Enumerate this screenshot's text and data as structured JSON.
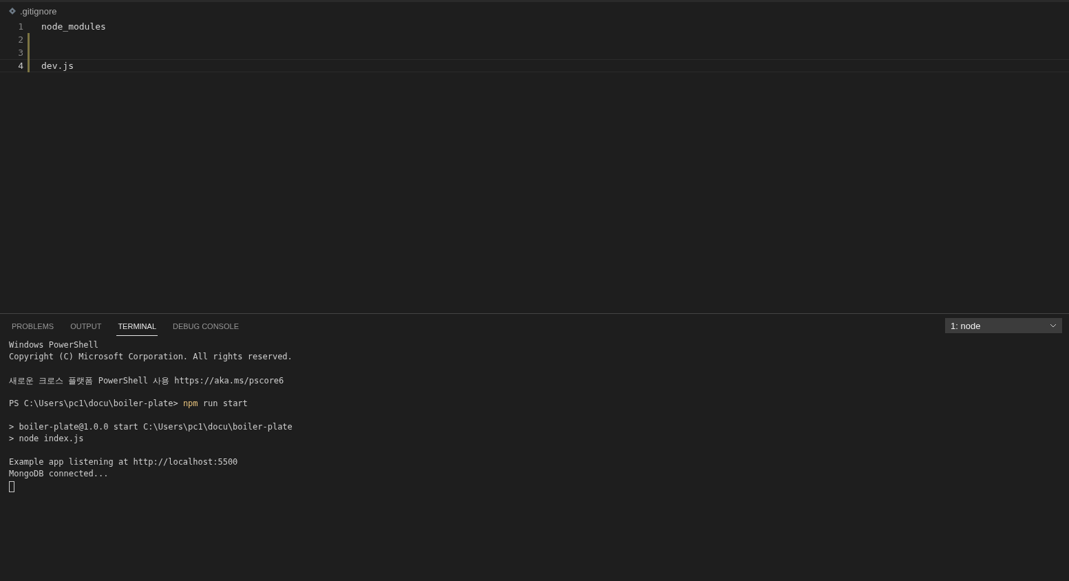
{
  "breadcrumb": {
    "file": ".gitignore"
  },
  "editor": {
    "lines": [
      {
        "number": "1",
        "text": "node_modules",
        "modified": false,
        "current": false
      },
      {
        "number": "2",
        "modified": true,
        "current": false
      },
      {
        "number": "3",
        "modified": true,
        "current": false
      },
      {
        "number": "4",
        "text": "dev.js",
        "modified": true,
        "current": true
      }
    ]
  },
  "panel": {
    "tabs": [
      {
        "label": "PROBLEMS",
        "selected": false
      },
      {
        "label": "OUTPUT",
        "selected": false
      },
      {
        "label": "TERMINAL",
        "selected": true
      },
      {
        "label": "DEBUG CONSOLE",
        "selected": false
      }
    ],
    "terminal_select": {
      "value": "1: node"
    },
    "terminal": {
      "blocks": [
        [
          [
            {
              "text": "Windows PowerShell",
              "kind": "plain"
            }
          ],
          [
            {
              "text": "Copyright (C) Microsoft Corporation. All rights reserved.",
              "kind": "plain"
            }
          ]
        ],
        [
          [
            {
              "text": "새로운 크로스 플랫폼 PowerShell 사용 https://aka.ms/pscore6",
              "kind": "plain"
            }
          ]
        ],
        [
          [
            {
              "text": "PS C:\\Users\\pc1\\docu\\boiler-plate> ",
              "kind": "plain"
            },
            {
              "text": "npm",
              "kind": "command"
            },
            {
              "text": " run start",
              "kind": "plain"
            }
          ]
        ],
        [
          [
            {
              "text": "> boiler-plate@1.0.0 start C:\\Users\\pc1\\docu\\boiler-plate",
              "kind": "plain"
            }
          ],
          [
            {
              "text": "> node index.js",
              "kind": "plain"
            }
          ]
        ],
        [
          [
            {
              "text": "Example app listening at http://localhost:5500",
              "kind": "plain"
            }
          ],
          [
            {
              "text": "MongoDB connected...",
              "kind": "plain"
            }
          ]
        ]
      ]
    }
  }
}
